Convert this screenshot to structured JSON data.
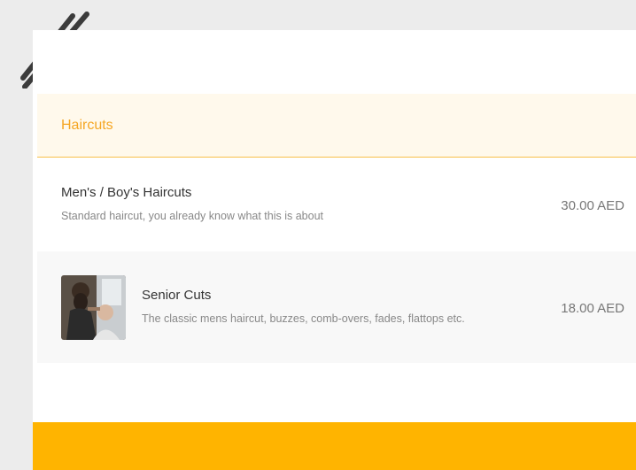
{
  "section": {
    "title": "Haircuts"
  },
  "services": [
    {
      "name": "Men's / Boy's Haircuts",
      "description": "Standard haircut, you already know what this is about",
      "price": "30.00 AED"
    },
    {
      "name": "Senior Cuts",
      "description": "The classic mens haircut, buzzes, comb-overs, fades, flattops etc.",
      "price": "18.00 AED",
      "image": "barber-photo"
    }
  ],
  "colors": {
    "accent": "#f5a623",
    "header_bg": "#fff9ec",
    "footer": "#ffb400",
    "page_bg": "#ececec"
  },
  "icons": {
    "decoration": "double-slash-lines"
  }
}
